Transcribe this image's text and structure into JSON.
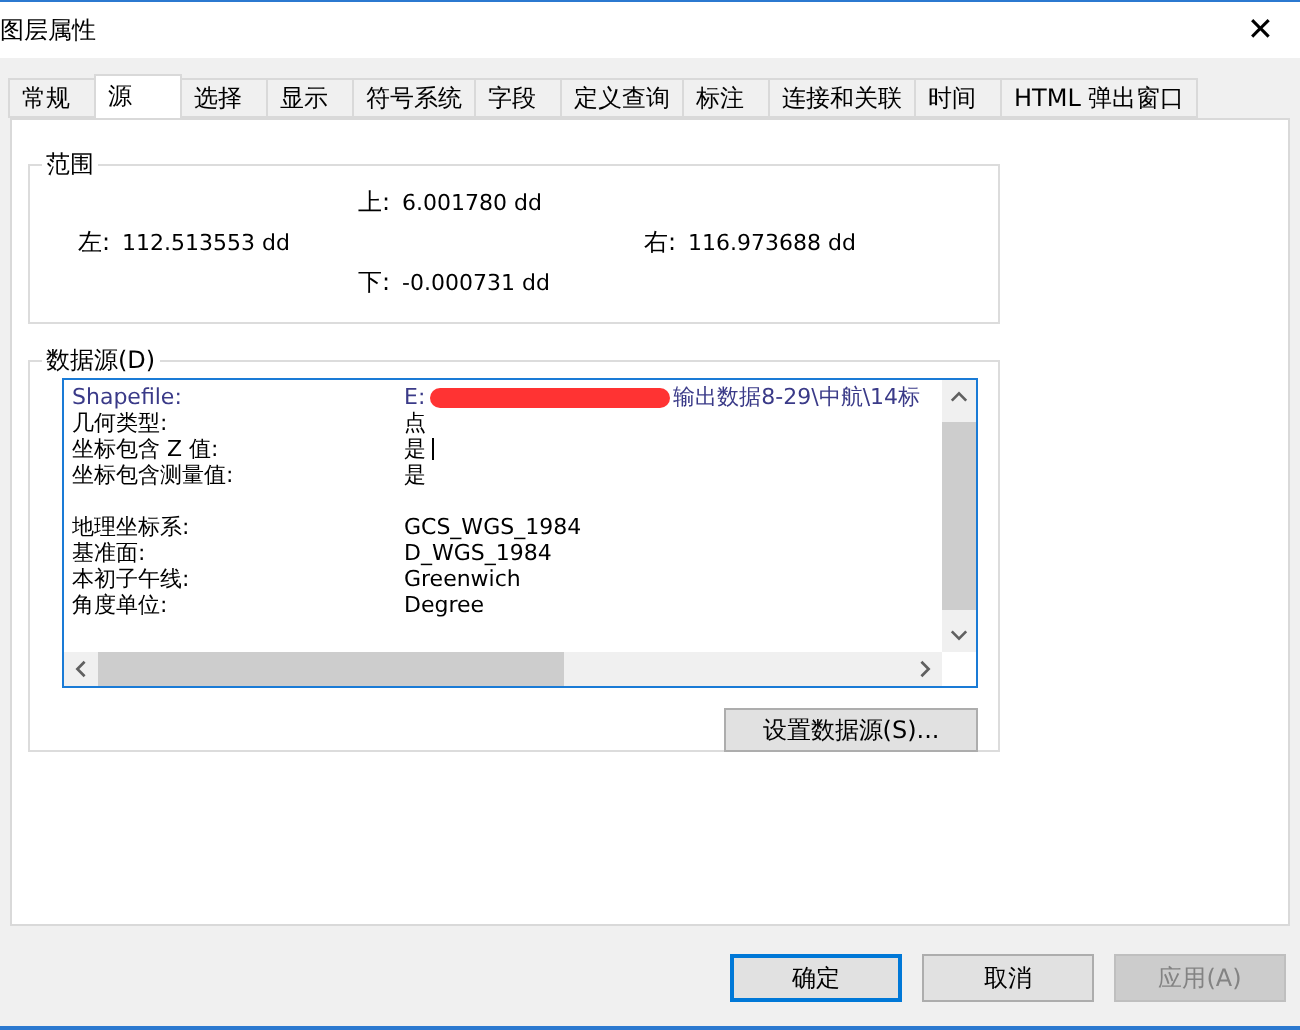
{
  "window": {
    "title": "图层属性",
    "close": "✕"
  },
  "tabs": [
    {
      "label": "常规",
      "selected": false
    },
    {
      "label": "源",
      "selected": true
    },
    {
      "label": "选择",
      "selected": false
    },
    {
      "label": "显示",
      "selected": false
    },
    {
      "label": "符号系统",
      "selected": false
    },
    {
      "label": "字段",
      "selected": false
    },
    {
      "label": "定义查询",
      "selected": false
    },
    {
      "label": "标注",
      "selected": false
    },
    {
      "label": "连接和关联",
      "selected": false
    },
    {
      "label": "时间",
      "selected": false
    },
    {
      "label": "HTML 弹出窗口",
      "selected": false
    }
  ],
  "extent": {
    "title": "范围",
    "top": {
      "label": "上:",
      "value": "6.001780 dd"
    },
    "left": {
      "label": "左:",
      "value": "112.513553 dd"
    },
    "right": {
      "label": "右:",
      "value": "116.973688 dd"
    },
    "bottom": {
      "label": "下:",
      "value": "-0.000731 dd"
    }
  },
  "data_source": {
    "title": "数据源(D)",
    "rows": [
      {
        "kind": "text",
        "label": "Shapefile:",
        "value": "E:",
        "value_tail": "输出数据8-29\\中航\\14标",
        "redacted": true,
        "highlight": true
      },
      {
        "kind": "text",
        "label": "几何类型:",
        "value": "点"
      },
      {
        "kind": "text",
        "label": "坐标包含 Z 值:",
        "value": "是",
        "caret": true
      },
      {
        "kind": "text",
        "label": "坐标包含测量值:",
        "value": "是"
      },
      {
        "kind": "gap"
      },
      {
        "kind": "text",
        "label": "地理坐标系:",
        "value": "GCS_WGS_1984"
      },
      {
        "kind": "text",
        "label": "基准面:",
        "value": "D_WGS_1984"
      },
      {
        "kind": "text",
        "label": "本初子午线:",
        "value": "Greenwich"
      },
      {
        "kind": "text",
        "label": "角度单位:",
        "value": "Degree"
      }
    ],
    "set_button": "设置数据源(S)..."
  },
  "buttons": [
    {
      "label": "确定",
      "default": true,
      "disabled": false
    },
    {
      "label": "取消",
      "default": false,
      "disabled": false
    },
    {
      "label": "应用(A)",
      "default": false,
      "disabled": true
    }
  ]
}
